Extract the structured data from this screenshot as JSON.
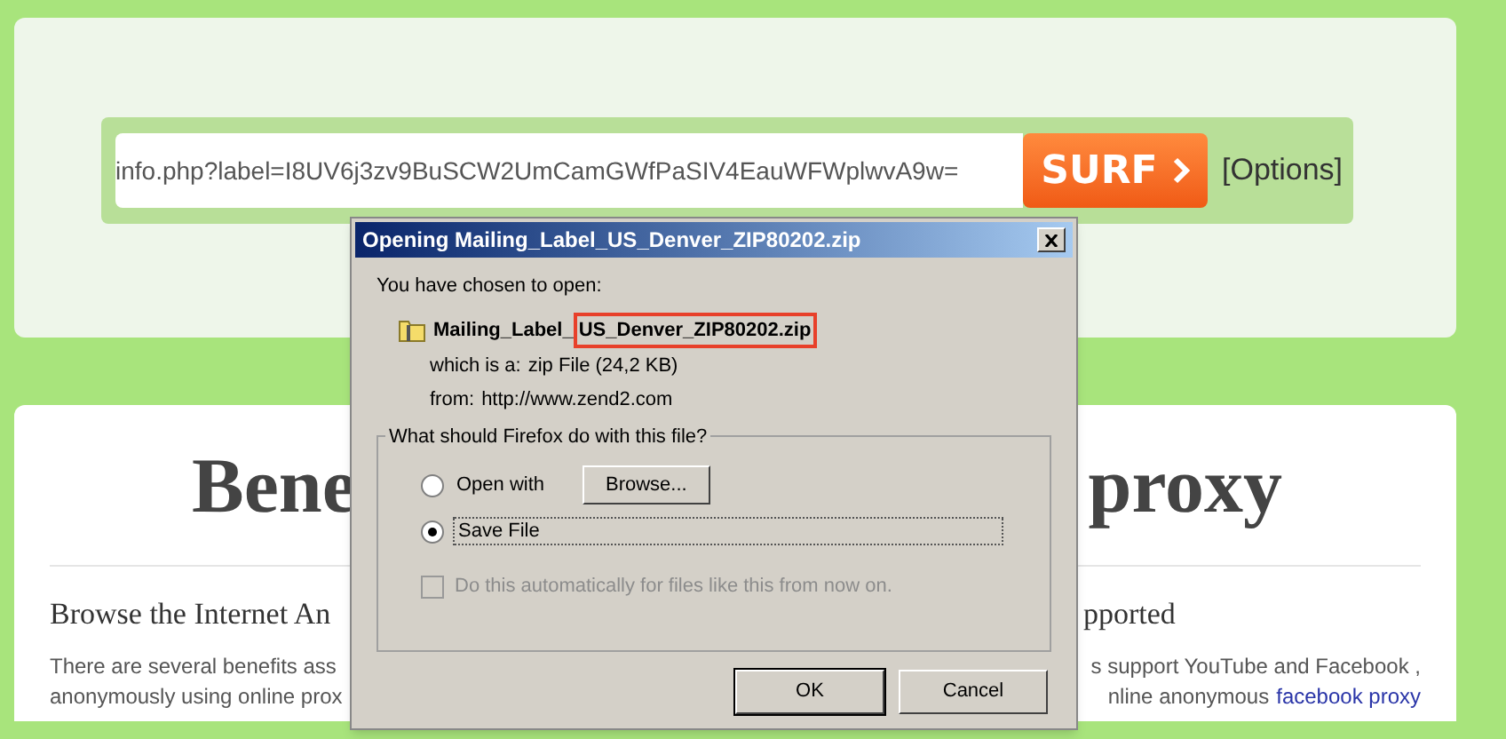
{
  "page": {
    "url_field": {
      "value": "info.php?label=I8UV6j3zv9BuSCW2UmCamGWfPaSIV4EauWFWplwvA9w="
    },
    "surf_button": "SURF",
    "options_link": "[Options]",
    "heading_left": "Bene",
    "heading_right": "proxy",
    "left_column": {
      "heading": "Browse the Internet An",
      "lines": [
        "There are several benefits ass",
        "anonymously using online prox"
      ]
    },
    "right_column": {
      "heading": "pported",
      "lines": [
        {
          "text": "s support YouTube and Facebook ,"
        },
        {
          "text": "nline anonymous",
          "link": "facebook proxy"
        }
      ]
    }
  },
  "dialog": {
    "title": "Opening Mailing_Label_US_Denver_ZIP80202.zip",
    "intro": "You have chosen to open:",
    "file_name": "Mailing_Label_",
    "file_name_highlighted": "US_Denver_ZIP80202.zip",
    "details": [
      {
        "label": "which is a:",
        "value": "zip File (24,2 KB)"
      },
      {
        "label": "from:",
        "value": "http://www.zend2.com"
      }
    ],
    "group_title": "What should Firefox do with this file?",
    "options": [
      {
        "kind": "open",
        "label": "Open with",
        "selected": false,
        "button": "Browse..."
      },
      {
        "kind": "save",
        "label": "Save File",
        "selected": true
      }
    ],
    "auto_checkbox": {
      "label": "Do this automatically for files like this from now on.",
      "checked": false,
      "disabled": true
    },
    "buttons": [
      "OK",
      "Cancel"
    ]
  }
}
